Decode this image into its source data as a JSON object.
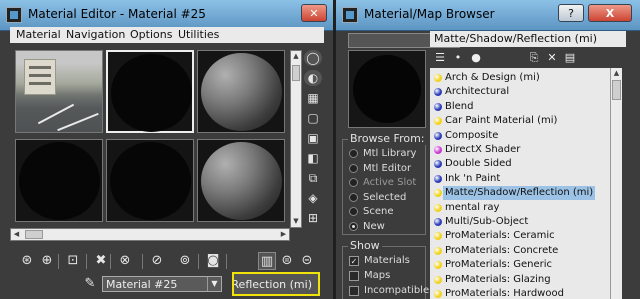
{
  "editor": {
    "title": "Material Editor - Material #25",
    "menu": [
      "Material",
      "Navigation",
      "Options",
      "Utilities"
    ],
    "slots": [
      {
        "kind": "photo"
      },
      {
        "kind": "black",
        "active": true
      },
      {
        "kind": "grey"
      },
      {
        "kind": "black"
      },
      {
        "kind": "black"
      },
      {
        "kind": "grey"
      }
    ],
    "side_tools": [
      "sphere-type-icon",
      "backlight-icon",
      "background-checker-icon",
      "uv-tiling-icon",
      "video-color-check-icon",
      "make-preview-icon",
      "options-icon",
      "select-by-material-icon",
      "material-navigator-icon"
    ],
    "bottom_tools": [
      "get-material-icon",
      "put-to-scene-icon",
      "assign-to-selection-icon",
      "reset-map-icon",
      "make-unique-icon",
      "put-to-library-icon",
      "material-id-channel-icon",
      "show-in-viewport-icon",
      "show-end-result-icon",
      "go-to-parent-icon",
      "go-forward-to-sibling-icon"
    ],
    "material_name": "Material #25",
    "material_type_label": "Matte/Shadow/Reflection (mi)"
  },
  "browser": {
    "title": "Material/Map Browser",
    "caption_help": "?",
    "caption_close": "X",
    "path": "Matte/Shadow/Reflection (mi)",
    "browse_from_title": "Browse From:",
    "browse_from": [
      {
        "label": "Mtl Library",
        "selected": false,
        "disabled": false
      },
      {
        "label": "Mtl Editor",
        "selected": false,
        "disabled": false
      },
      {
        "label": "Active Slot",
        "selected": false,
        "disabled": true
      },
      {
        "label": "Selected",
        "selected": false,
        "disabled": false
      },
      {
        "label": "Scene",
        "selected": false,
        "disabled": false
      },
      {
        "label": "New",
        "selected": true,
        "disabled": false
      }
    ],
    "show_title": "Show",
    "show": [
      {
        "label": "Materials",
        "checked": true
      },
      {
        "label": "Maps",
        "checked": false
      },
      {
        "label": "Incompatible",
        "checked": false
      }
    ],
    "items": [
      {
        "label": "Arch & Design (mi)",
        "color": "#f2d21b"
      },
      {
        "label": "Architectural",
        "color": "#2a3cb8"
      },
      {
        "label": "Blend",
        "color": "#2a3cb8"
      },
      {
        "label": "Car Paint Material (mi)",
        "color": "#f2d21b"
      },
      {
        "label": "Composite",
        "color": "#2a3cb8"
      },
      {
        "label": "DirectX Shader",
        "color": "#c93ad0"
      },
      {
        "label": "Double Sided",
        "color": "#2a3cb8"
      },
      {
        "label": "Ink 'n Paint",
        "color": "#2a3cb8"
      },
      {
        "label": "Matte/Shadow/Reflection (mi)",
        "color": "#f2d21b",
        "selected": true
      },
      {
        "label": "mental ray",
        "color": "#f2d21b"
      },
      {
        "label": "Multi/Sub-Object",
        "color": "#2a3cb8"
      },
      {
        "label": "ProMaterials: Ceramic",
        "color": "#f2d21b"
      },
      {
        "label": "ProMaterials: Concrete",
        "color": "#f2d21b"
      },
      {
        "label": "ProMaterials: Generic",
        "color": "#f2d21b"
      },
      {
        "label": "ProMaterials: Glazing",
        "color": "#f2d21b"
      },
      {
        "label": "ProMaterials: Hardwood",
        "color": "#f2d21b"
      }
    ]
  }
}
